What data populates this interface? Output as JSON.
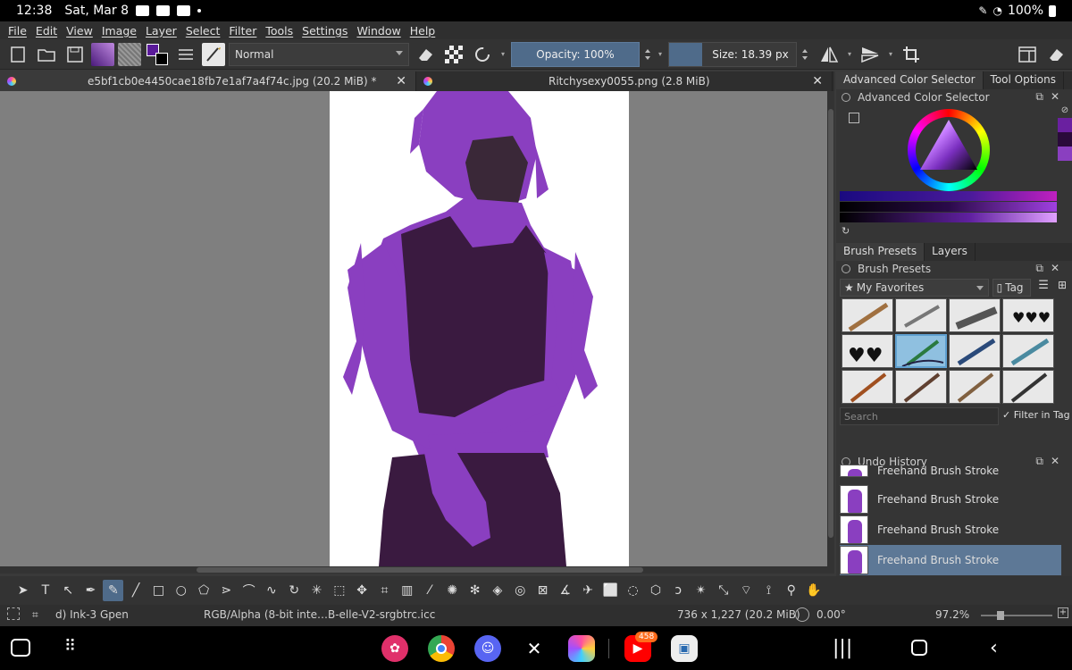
{
  "statusbar": {
    "time": "12:38",
    "date": "Sat, Mar 8",
    "battery": "100%"
  },
  "menu": [
    "File",
    "Edit",
    "View",
    "Image",
    "Layer",
    "Select",
    "Filter",
    "Tools",
    "Settings",
    "Window",
    "Help"
  ],
  "toolbar": {
    "blend_mode": "Normal",
    "opacity": "Opacity: 100%",
    "size": "Size: 18.39 px",
    "fg_color": "#5a1a9a",
    "bg_color": "#000000"
  },
  "tabs": [
    {
      "title": "e5bf1cb0e4450cae18fb7e1af7a4f74c.jpg (20.2 MiB) *",
      "active": true
    },
    {
      "title": "Ritchysexy0055.png (2.8 MiB)",
      "active": false
    }
  ],
  "dock": {
    "top_tabs": [
      "Advanced Color Selector",
      "Tool Options"
    ],
    "color_selector_title": "Advanced Color Selector",
    "mid_tabs": [
      "Brush Presets",
      "Layers"
    ],
    "brush_presets_title": "Brush Presets",
    "tag_filter": "My Favorites",
    "tag_button": "Tag",
    "search_placeholder": "Search",
    "filter_in_tag": "Filter in Tag",
    "undo_title": "Undo History",
    "undo_items": [
      "Freehand Brush Stroke",
      "Freehand Brush Stroke",
      "Freehand Brush Stroke",
      "Freehand Brush Stroke"
    ]
  },
  "statusline": {
    "brush": "d) Ink-3 Gpen",
    "colorspace": "RGB/Alpha (8-bit inte…B-elle-V2-srgbtrc.icc",
    "dimensions": "736 x 1,227 (20.2 MiB)",
    "rotation": "0.00°",
    "zoom": "97.2%"
  },
  "navbar": {
    "youtube_badge": "458"
  },
  "colors": {
    "accent": "#4f6b8a",
    "figure_purple": "#8a3fc0",
    "figure_dark": "#3a1a40"
  }
}
